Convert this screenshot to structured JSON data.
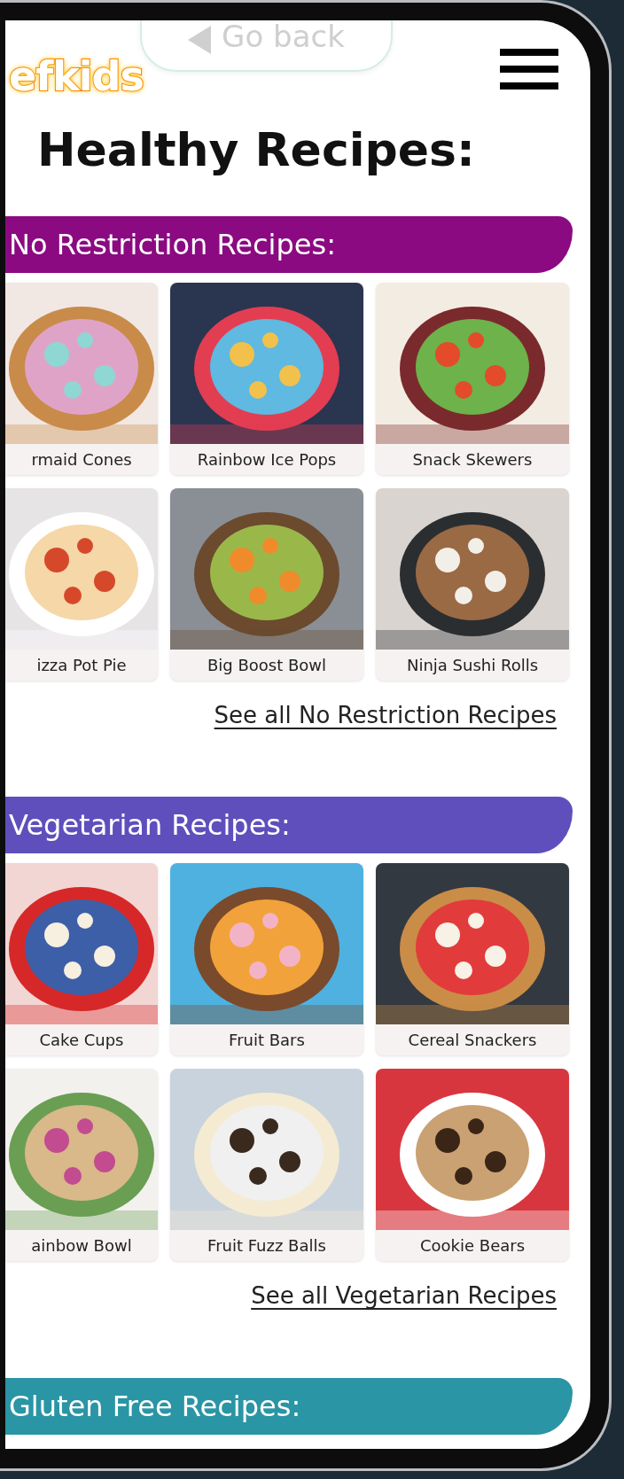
{
  "header": {
    "back_button": "Go back",
    "logo": "efkids"
  },
  "title": "Healthy Recipes:",
  "sections": [
    {
      "heading": "No Restriction Recipes:",
      "color": "#8b0a82",
      "recipes": [
        {
          "label": "rmaid Cones"
        },
        {
          "label": "Rainbow Ice Pops"
        },
        {
          "label": "Snack Skewers"
        },
        {
          "label": "izza Pot Pie"
        },
        {
          "label": "Big Boost Bowl"
        },
        {
          "label": "Ninja Sushi Rolls"
        }
      ],
      "link": "See all No Restriction Recipes"
    },
    {
      "heading": "Vegetarian Recipes:",
      "color": "#5e4fbd",
      "recipes": [
        {
          "label": "Cake Cups"
        },
        {
          "label": "Fruit Bars"
        },
        {
          "label": "Cereal Snackers"
        },
        {
          "label": "ainbow Bowl"
        },
        {
          "label": "Fruit Fuzz Balls"
        },
        {
          "label": "Cookie Bears"
        }
      ],
      "link": "See all Vegetarian Recipes"
    },
    {
      "heading": "Gluten Free Recipes:",
      "color": "#2995a5"
    }
  ]
}
